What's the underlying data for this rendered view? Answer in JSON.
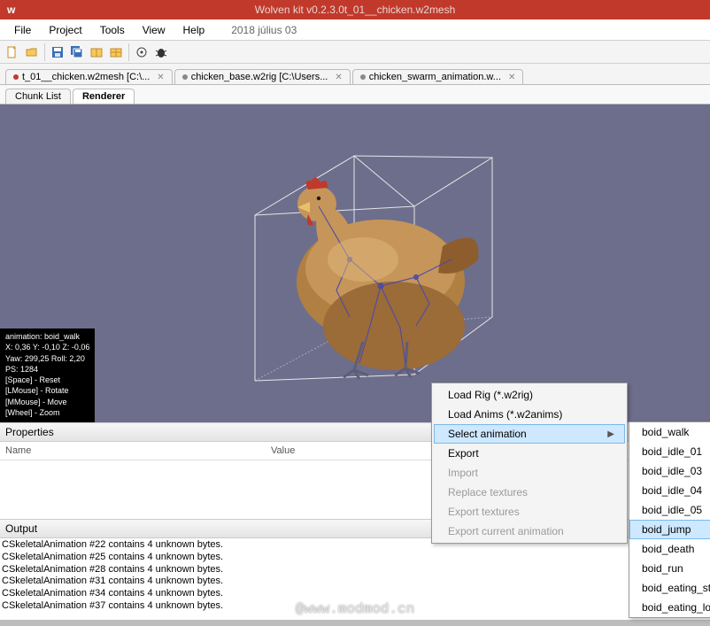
{
  "titlebar": {
    "title": "Wolven kit v0.2.3.0t_01__chicken.w2mesh"
  },
  "menubar": {
    "items": [
      "File",
      "Project",
      "Tools",
      "View",
      "Help"
    ],
    "date": "2018 július 03"
  },
  "doctabs": [
    {
      "label": "t_01__chicken.w2mesh [C:\\...",
      "active": true
    },
    {
      "label": "chicken_base.w2rig [C:\\Users...",
      "active": false
    },
    {
      "label": "chicken_swarm_animation.w...",
      "active": false
    }
  ],
  "subtabs": [
    {
      "label": "Chunk List",
      "active": false
    },
    {
      "label": "Renderer",
      "active": true
    }
  ],
  "viewport": {
    "stats": [
      "animation: boid_walk",
      "X: 0,36 Y: -0,10 Z: -0,06",
      "Yaw: 299,25 Roll: 2,20",
      "PS: 1284",
      "[Space] - Reset",
      "[LMouse] - Rotate",
      "[MMouse] - Move",
      "[Wheel] - Zoom"
    ]
  },
  "properties": {
    "title": "Properties",
    "cols": {
      "name": "Name",
      "value": "Value"
    }
  },
  "output": {
    "title": "Output",
    "lines": [
      "CSkeletalAnimation #22 contains 4 unknown bytes.",
      "CSkeletalAnimation #25 contains 4 unknown bytes.",
      "CSkeletalAnimation #28 contains 4 unknown bytes.",
      "CSkeletalAnimation #31 contains 4 unknown bytes.",
      "CSkeletalAnimation #34 contains 4 unknown bytes.",
      "CSkeletalAnimation #37 contains 4 unknown bytes."
    ]
  },
  "context_menu": {
    "items": [
      {
        "label": "Load Rig (*.w2rig)",
        "enabled": true
      },
      {
        "label": "Load Anims (*.w2anims)",
        "enabled": true
      },
      {
        "label": "Select animation",
        "enabled": true,
        "submenu": true,
        "highlight": true
      },
      {
        "label": "Export",
        "enabled": true
      },
      {
        "label": "Import",
        "enabled": false
      },
      {
        "label": "Replace textures",
        "enabled": false
      },
      {
        "label": "Export textures",
        "enabled": false
      },
      {
        "label": "Export current animation",
        "enabled": false
      }
    ]
  },
  "anim_submenu": [
    {
      "label": "boid_walk"
    },
    {
      "label": "boid_idle_01"
    },
    {
      "label": "boid_idle_03"
    },
    {
      "label": "boid_idle_04"
    },
    {
      "label": "boid_idle_05"
    },
    {
      "label": "boid_jump",
      "highlight": true
    },
    {
      "label": "boid_death"
    },
    {
      "label": "boid_run"
    },
    {
      "label": "boid_eating_sta"
    },
    {
      "label": "boid_eating_loo"
    }
  ],
  "watermark": "@www.modmod.cn"
}
